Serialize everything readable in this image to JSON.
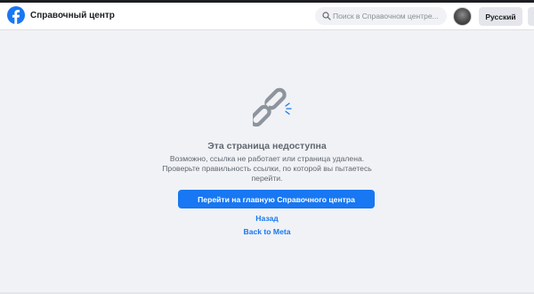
{
  "header": {
    "site_title": "Справочный центр",
    "logo_icon": "facebook-logo-icon",
    "search": {
      "placeholder": "Поиск в Справочном центре...",
      "value": "",
      "icon": "search-icon"
    },
    "avatar": "avatar",
    "language_label": "Русский"
  },
  "main": {
    "icon": "broken-link-icon",
    "title": "Эта страница недоступна",
    "description": "Возможно, ссылка не работает или страница удалена. Проверьте правильность ссылки, по которой вы пытаетесь перейти.",
    "home_button_label": "Перейти на главную Справочного центра",
    "back_link_label": "Назад",
    "meta_link_label": "Back to Meta"
  },
  "colors": {
    "accent": "#1877f2",
    "background": "#f0f2f5",
    "text_secondary": "#606770"
  }
}
